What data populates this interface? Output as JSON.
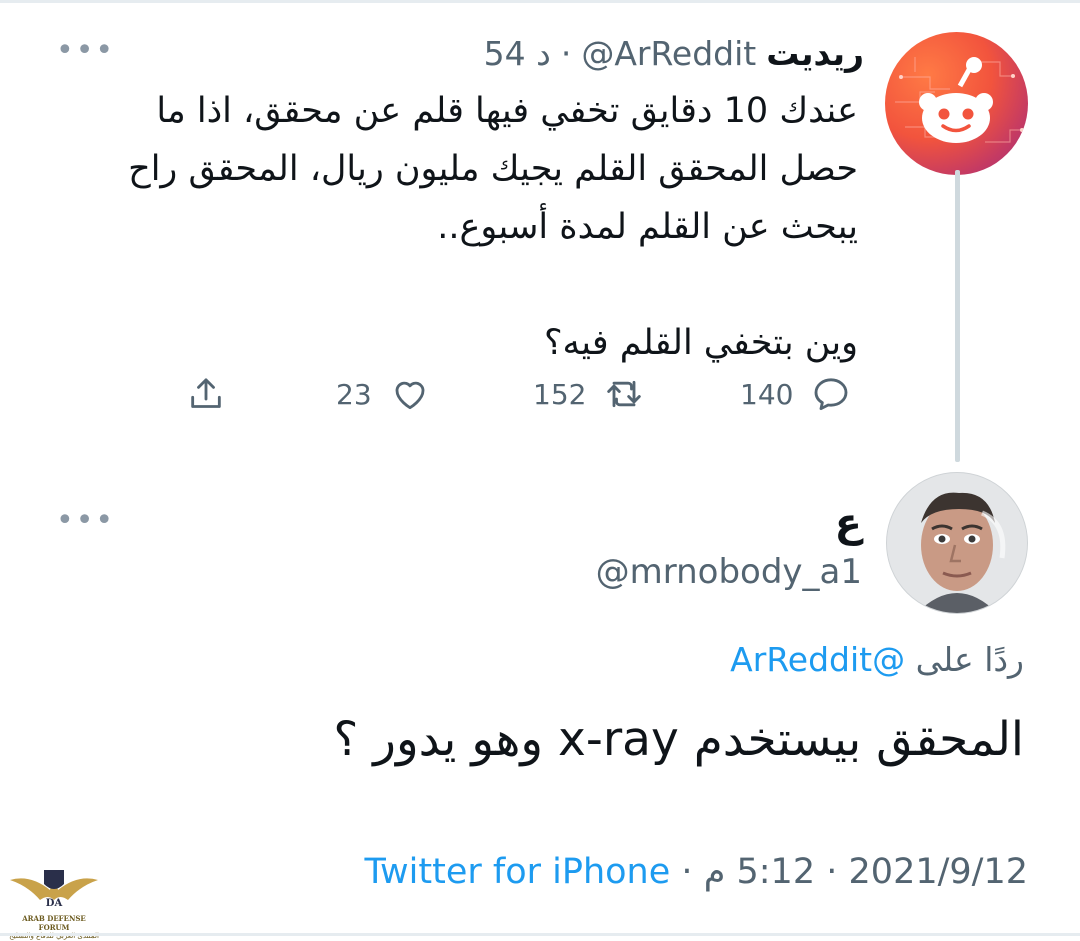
{
  "tweet": {
    "author_name": "ريديت",
    "handle": "@ArReddit",
    "separator": "·",
    "time": "54 د",
    "body": "عندك 10 دقايق تخفي فيها قلم عن محقق، اذا ما حصل المحقق القلم يجيك مليون ريال، المحقق راح يبحث عن القلم لمدة أسبوع..\n\nوين بتخفي القلم فيه؟",
    "replies": "140",
    "retweets": "152",
    "likes": "23"
  },
  "reply": {
    "author_name": "ع",
    "handle": "@mrnobody_a1",
    "replying_to_label": "ردًا على",
    "replying_to_handle": "@ArReddit",
    "body": "المحقق بيستخدم x-ray وهو يدور ؟",
    "date": "2021/9/12",
    "separator": "·",
    "time": "5:12 م",
    "source": "Twitter for iPhone"
  },
  "icons": {
    "more": "more-icon",
    "reply": "reply-icon",
    "retweet": "retweet-icon",
    "like": "heart-icon",
    "share": "share-icon"
  },
  "watermark": {
    "line1": "ARAB DEFENSE FORUM",
    "line2": "المنتدى العربي للدفاع والتسليح"
  },
  "colors": {
    "accent": "#1d9bf0",
    "secondary_text": "#536471",
    "primary_text": "#0f1419"
  }
}
